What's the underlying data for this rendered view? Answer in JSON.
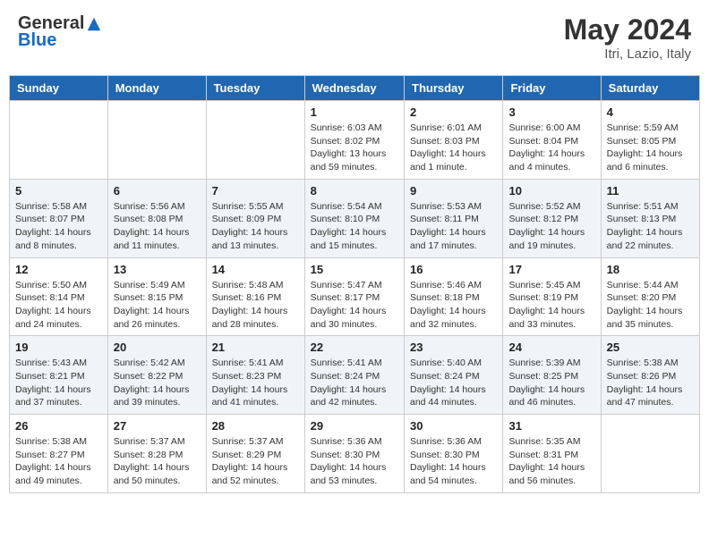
{
  "header": {
    "logo_general": "General",
    "logo_blue": "Blue",
    "month_title": "May 2024",
    "location": "Itri, Lazio, Italy"
  },
  "days_of_week": [
    "Sunday",
    "Monday",
    "Tuesday",
    "Wednesday",
    "Thursday",
    "Friday",
    "Saturday"
  ],
  "weeks": [
    [
      {
        "day": "",
        "info": ""
      },
      {
        "day": "",
        "info": ""
      },
      {
        "day": "",
        "info": ""
      },
      {
        "day": "1",
        "info": "Sunrise: 6:03 AM\nSunset: 8:02 PM\nDaylight: 13 hours\nand 59 minutes."
      },
      {
        "day": "2",
        "info": "Sunrise: 6:01 AM\nSunset: 8:03 PM\nDaylight: 14 hours\nand 1 minute."
      },
      {
        "day": "3",
        "info": "Sunrise: 6:00 AM\nSunset: 8:04 PM\nDaylight: 14 hours\nand 4 minutes."
      },
      {
        "day": "4",
        "info": "Sunrise: 5:59 AM\nSunset: 8:05 PM\nDaylight: 14 hours\nand 6 minutes."
      }
    ],
    [
      {
        "day": "5",
        "info": "Sunrise: 5:58 AM\nSunset: 8:07 PM\nDaylight: 14 hours\nand 8 minutes."
      },
      {
        "day": "6",
        "info": "Sunrise: 5:56 AM\nSunset: 8:08 PM\nDaylight: 14 hours\nand 11 minutes."
      },
      {
        "day": "7",
        "info": "Sunrise: 5:55 AM\nSunset: 8:09 PM\nDaylight: 14 hours\nand 13 minutes."
      },
      {
        "day": "8",
        "info": "Sunrise: 5:54 AM\nSunset: 8:10 PM\nDaylight: 14 hours\nand 15 minutes."
      },
      {
        "day": "9",
        "info": "Sunrise: 5:53 AM\nSunset: 8:11 PM\nDaylight: 14 hours\nand 17 minutes."
      },
      {
        "day": "10",
        "info": "Sunrise: 5:52 AM\nSunset: 8:12 PM\nDaylight: 14 hours\nand 19 minutes."
      },
      {
        "day": "11",
        "info": "Sunrise: 5:51 AM\nSunset: 8:13 PM\nDaylight: 14 hours\nand 22 minutes."
      }
    ],
    [
      {
        "day": "12",
        "info": "Sunrise: 5:50 AM\nSunset: 8:14 PM\nDaylight: 14 hours\nand 24 minutes."
      },
      {
        "day": "13",
        "info": "Sunrise: 5:49 AM\nSunset: 8:15 PM\nDaylight: 14 hours\nand 26 minutes."
      },
      {
        "day": "14",
        "info": "Sunrise: 5:48 AM\nSunset: 8:16 PM\nDaylight: 14 hours\nand 28 minutes."
      },
      {
        "day": "15",
        "info": "Sunrise: 5:47 AM\nSunset: 8:17 PM\nDaylight: 14 hours\nand 30 minutes."
      },
      {
        "day": "16",
        "info": "Sunrise: 5:46 AM\nSunset: 8:18 PM\nDaylight: 14 hours\nand 32 minutes."
      },
      {
        "day": "17",
        "info": "Sunrise: 5:45 AM\nSunset: 8:19 PM\nDaylight: 14 hours\nand 33 minutes."
      },
      {
        "day": "18",
        "info": "Sunrise: 5:44 AM\nSunset: 8:20 PM\nDaylight: 14 hours\nand 35 minutes."
      }
    ],
    [
      {
        "day": "19",
        "info": "Sunrise: 5:43 AM\nSunset: 8:21 PM\nDaylight: 14 hours\nand 37 minutes."
      },
      {
        "day": "20",
        "info": "Sunrise: 5:42 AM\nSunset: 8:22 PM\nDaylight: 14 hours\nand 39 minutes."
      },
      {
        "day": "21",
        "info": "Sunrise: 5:41 AM\nSunset: 8:23 PM\nDaylight: 14 hours\nand 41 minutes."
      },
      {
        "day": "22",
        "info": "Sunrise: 5:41 AM\nSunset: 8:24 PM\nDaylight: 14 hours\nand 42 minutes."
      },
      {
        "day": "23",
        "info": "Sunrise: 5:40 AM\nSunset: 8:24 PM\nDaylight: 14 hours\nand 44 minutes."
      },
      {
        "day": "24",
        "info": "Sunrise: 5:39 AM\nSunset: 8:25 PM\nDaylight: 14 hours\nand 46 minutes."
      },
      {
        "day": "25",
        "info": "Sunrise: 5:38 AM\nSunset: 8:26 PM\nDaylight: 14 hours\nand 47 minutes."
      }
    ],
    [
      {
        "day": "26",
        "info": "Sunrise: 5:38 AM\nSunset: 8:27 PM\nDaylight: 14 hours\nand 49 minutes."
      },
      {
        "day": "27",
        "info": "Sunrise: 5:37 AM\nSunset: 8:28 PM\nDaylight: 14 hours\nand 50 minutes."
      },
      {
        "day": "28",
        "info": "Sunrise: 5:37 AM\nSunset: 8:29 PM\nDaylight: 14 hours\nand 52 minutes."
      },
      {
        "day": "29",
        "info": "Sunrise: 5:36 AM\nSunset: 8:30 PM\nDaylight: 14 hours\nand 53 minutes."
      },
      {
        "day": "30",
        "info": "Sunrise: 5:36 AM\nSunset: 8:30 PM\nDaylight: 14 hours\nand 54 minutes."
      },
      {
        "day": "31",
        "info": "Sunrise: 5:35 AM\nSunset: 8:31 PM\nDaylight: 14 hours\nand 56 minutes."
      },
      {
        "day": "",
        "info": ""
      }
    ]
  ]
}
